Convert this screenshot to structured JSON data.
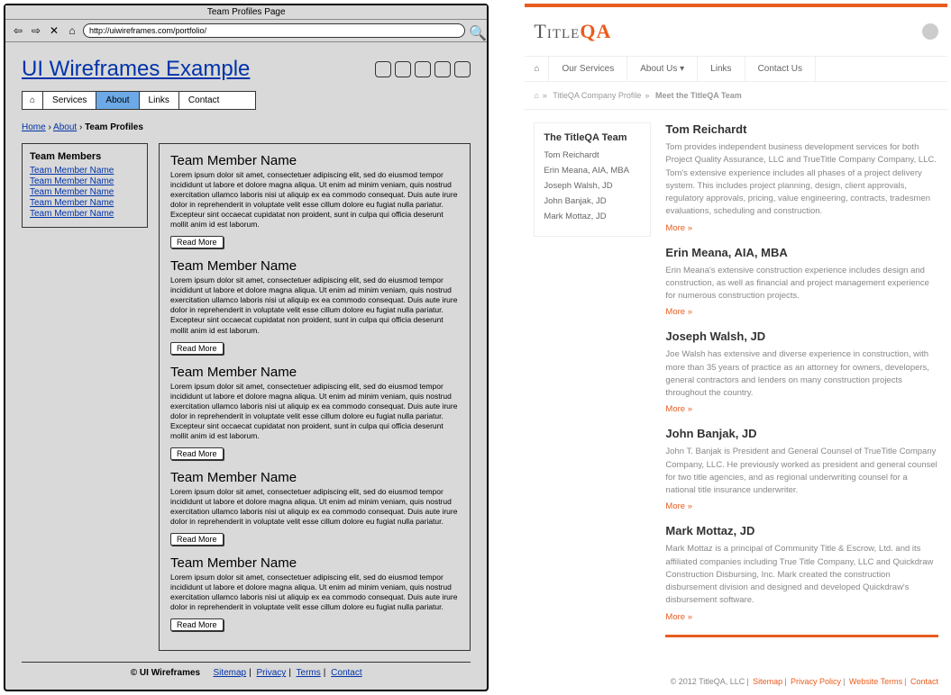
{
  "wireframe": {
    "window_title": "Team Profiles Page",
    "url": "http://uiwireframes.com/portfolio/",
    "logo": "UI Wireframes Example",
    "nav": [
      "Services",
      "About",
      "Links",
      "Contact"
    ],
    "breadcrumb": {
      "home": "Home",
      "about": "About",
      "current": "Team Profiles"
    },
    "sidebar": {
      "title": "Team Members",
      "items": [
        "Team Member Name",
        "Team Member Name",
        "Team Member Name",
        "Team Member Name",
        "Team Member Name"
      ]
    },
    "members": [
      {
        "name": "Team Member Name",
        "bio": "Lorem ipsum dolor sit amet, consectetuer adipiscing elit, sed do eiusmod tempor incididunt ut labore et dolore magna aliqua. Ut enim ad minim veniam, quis nostrud exercitation ullamco laboris nisi ut aliquip ex ea commodo consequat. Duis aute irure dolor in reprehenderit in voluptate velit esse cillum dolore eu fugiat nulla pariatur. Excepteur sint occaecat cupidatat non proident, sunt in culpa qui officia deserunt mollit anim id est laborum.",
        "more": "Read More"
      },
      {
        "name": "Team Member Name",
        "bio": "Lorem ipsum dolor sit amet, consectetuer adipiscing elit, sed do eiusmod tempor incididunt ut labore et dolore magna aliqua. Ut enim ad minim veniam, quis nostrud exercitation ullamco laboris nisi ut aliquip ex ea commodo consequat. Duis aute irure dolor in reprehenderit in voluptate velit esse cillum dolore eu fugiat nulla pariatur. Excepteur sint occaecat cupidatat non proident, sunt in culpa qui officia deserunt mollit anim id est laborum.",
        "more": "Read More"
      },
      {
        "name": "Team Member Name",
        "bio": "Lorem ipsum dolor sit amet, consectetuer adipiscing elit, sed do eiusmod tempor incididunt ut labore et dolore magna aliqua. Ut enim ad minim veniam, quis nostrud exercitation ullamco laboris nisi ut aliquip ex ea commodo consequat. Duis aute irure dolor in reprehenderit in voluptate velit esse cillum dolore eu fugiat nulla pariatur. Excepteur sint occaecat cupidatat non proident, sunt in culpa qui officia deserunt mollit anim id est laborum.",
        "more": "Read More"
      },
      {
        "name": "Team Member Name",
        "bio": "Lorem ipsum dolor sit amet, consectetuer adipiscing elit, sed do eiusmod tempor incididunt ut labore et dolore magna aliqua. Ut enim ad minim veniam, quis nostrud exercitation ullamco laboris nisi ut aliquip ex ea commodo consequat. Duis aute irure dolor in reprehenderit in voluptate velit esse cillum dolore eu fugiat nulla pariatur.",
        "more": "Read More"
      },
      {
        "name": "Team Member Name",
        "bio": "Lorem ipsum dolor sit amet, consectetuer adipiscing elit, sed do eiusmod tempor incididunt ut labore et dolore magna aliqua. Ut enim ad minim veniam, quis nostrud exercitation ullamco laboris nisi ut aliquip ex ea commodo consequat. Duis aute irure dolor in reprehenderit in voluptate velit esse cillum dolore eu fugiat nulla pariatur.",
        "more": "Read More"
      }
    ],
    "footer": {
      "copyright": "© UI Wireframes",
      "links": [
        "Sitemap",
        "Privacy",
        "Terms",
        "Contact"
      ]
    }
  },
  "realsite": {
    "logo_part1": "Title",
    "logo_part2": "QA",
    "nav": [
      "Our Services",
      "About Us",
      "Links",
      "Contact Us"
    ],
    "breadcrumb": {
      "a": "TitleQA Company Profile",
      "b": "Meet the TitleQA Team"
    },
    "sidebar": {
      "title": "The TitleQA Team",
      "items": [
        "Tom Reichardt",
        "Erin Meana, AIA, MBA",
        "Joseph Walsh, JD",
        "John Banjak, JD",
        "Mark Mottaz, JD"
      ]
    },
    "members": [
      {
        "name": "Tom Reichardt",
        "bio": "Tom provides independent business development services for both Project Quality Assurance, LLC and TrueTitle Company Company, LLC. Tom's extensive experience includes all phases of a project delivery system. This includes project planning, design, client approvals, regulatory approvals, pricing, value engineering, contracts, tradesmen evaluations, scheduling and construction.",
        "more": "More »"
      },
      {
        "name": "Erin Meana, AIA, MBA",
        "bio": "Erin Meana's extensive construction experience includes design and construction, as well as financial and project management experience for numerous construction projects.",
        "more": "More »"
      },
      {
        "name": "Joseph Walsh, JD",
        "bio": "Joe Walsh has extensive and diverse experience in construction, with more than 35 years of practice as an attorney for owners, developers, general contractors and lenders on many construction projects throughout the country.",
        "more": "More »"
      },
      {
        "name": "John Banjak, JD",
        "bio": "John T. Banjak is President and General Counsel of TrueTitle Company Company, LLC. He previously worked as president and general counsel for two title agencies, and as regional underwriting counsel for a national title insurance underwriter.",
        "more": "More »"
      },
      {
        "name": "Mark Mottaz, JD",
        "bio": "Mark Mottaz is a principal of Community Title & Escrow, Ltd. and its affiliated companies including True Title Company, LLC and Quickdraw Construction Disbursing, Inc. Mark created the construction disbursement division and designed and developed Quickdraw's disbursement software.",
        "more": "More »"
      }
    ],
    "footer": {
      "copyright": "© 2012 TitleQA, LLC",
      "links": [
        "Sitemap",
        "Privacy Policy",
        "Website Terms",
        "Contact"
      ]
    }
  }
}
